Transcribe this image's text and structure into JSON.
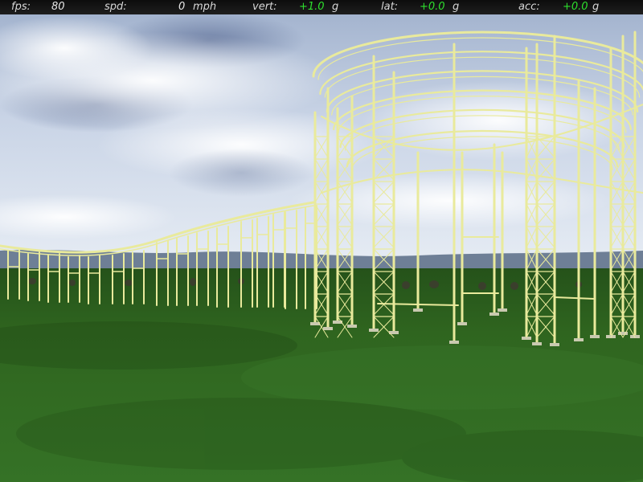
{
  "hud": {
    "fps": {
      "label": "fps:",
      "value": "80"
    },
    "spd": {
      "label": "spd:",
      "value": "0",
      "unit": "mph"
    },
    "vert": {
      "label": "vert:",
      "value": "+1.0",
      "unit": "g"
    },
    "lat": {
      "label": "lat:",
      "value": "+0.0",
      "unit": "g"
    },
    "acc": {
      "label": "acc:",
      "value": "+0.0",
      "unit": "g"
    }
  },
  "colors": {
    "track": "#e9ea9c",
    "g_value": "#2ee02e",
    "grass": "#2f641f",
    "sky_top": "#a9b7cf"
  },
  "scene": {
    "description_icon": "roller-coaster-helix-icon"
  }
}
